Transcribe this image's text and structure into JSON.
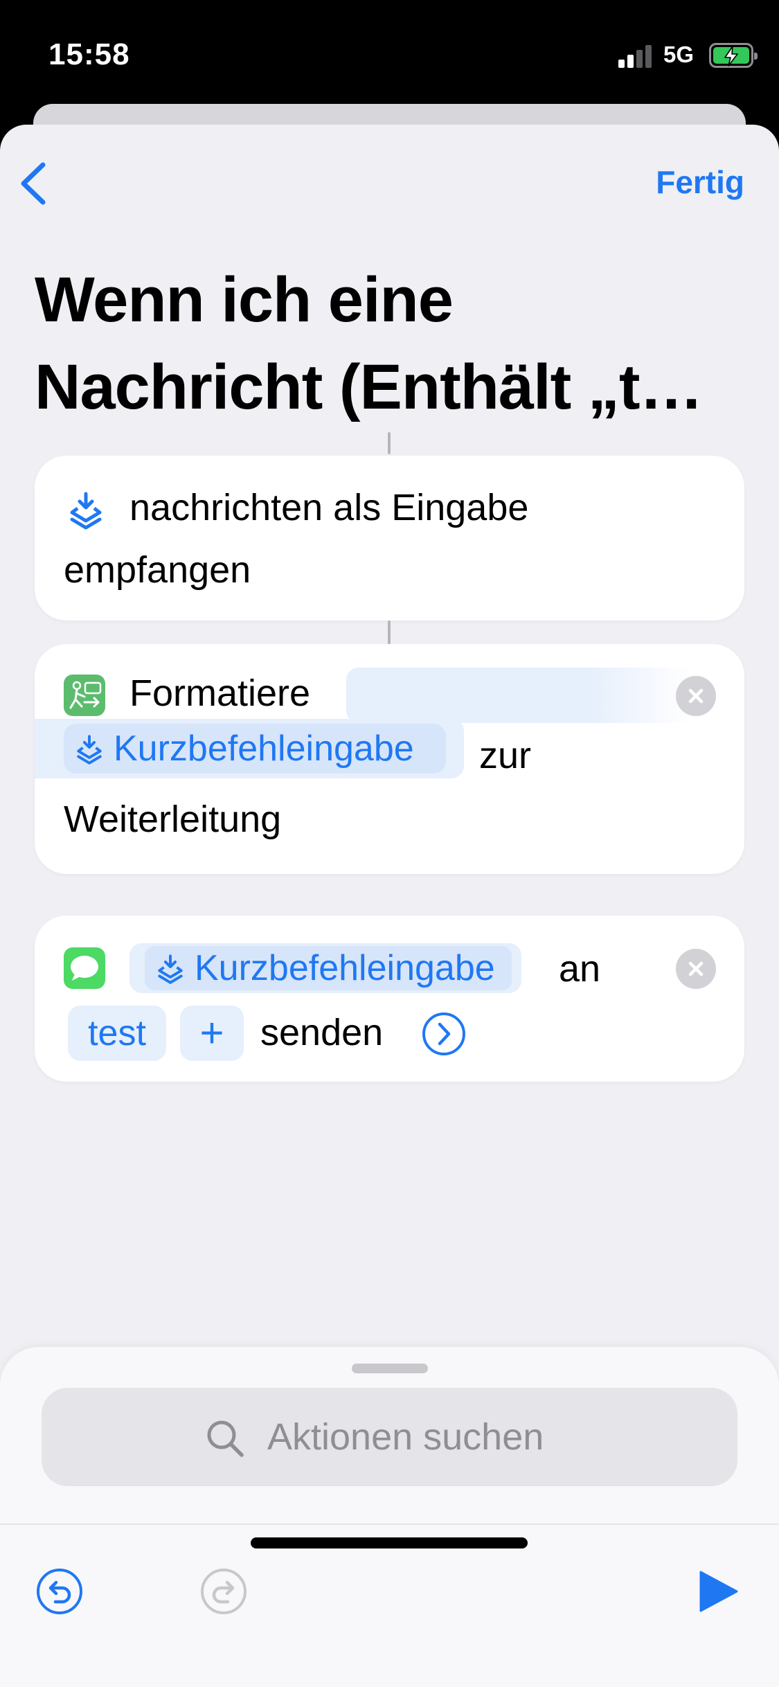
{
  "status": {
    "time": "15:58",
    "network": "5G"
  },
  "nav": {
    "done_label": "Fertig"
  },
  "title": "Wenn ich eine Nachricht (Enthält „t…",
  "action1": {
    "text_line1": "nachrichten als Eingabe",
    "text_line2": "empfangen"
  },
  "action2": {
    "verb": "Formatiere",
    "token_label": "Kurzbefehleingabe",
    "text_after": "zur",
    "text_line3": "Weiterleitung"
  },
  "action3": {
    "token_label": "Kurzbefehleingabe",
    "text_after": "an",
    "recipient": "test",
    "add_label": "+",
    "send_label": "senden"
  },
  "search": {
    "placeholder": "Aktionen suchen"
  },
  "colors": {
    "accent": "#1f78f2",
    "background": "#efeff4",
    "card": "#ffffff",
    "token_bg": "#e6effc"
  }
}
